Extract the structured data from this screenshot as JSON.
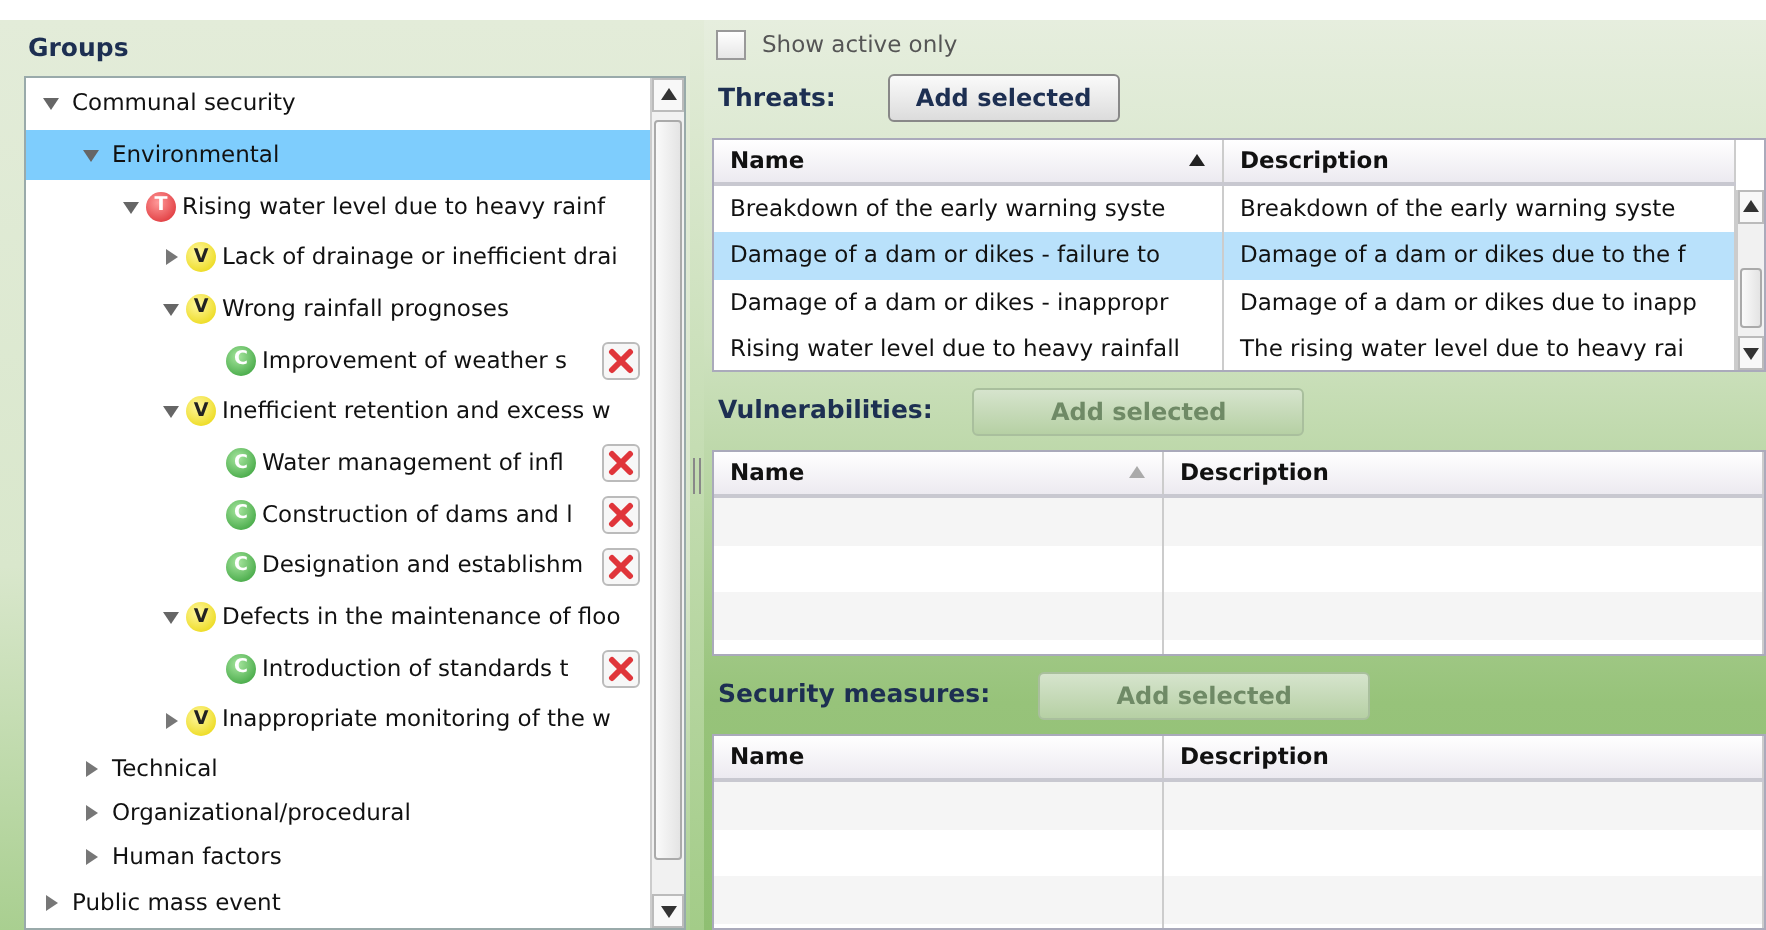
{
  "groups_panel": {
    "title": "Groups",
    "tree": [
      {
        "label": "Communal security",
        "kind": "group",
        "expanded": true,
        "selected": false,
        "children": [
          {
            "label": "Environmental",
            "kind": "group",
            "expanded": true,
            "selected": true,
            "children": [
              {
                "label": "Rising water level due to heavy rainf",
                "kind": "threat",
                "badge": "T",
                "expanded": true,
                "selected": false,
                "children": [
                  {
                    "label": "Lack of drainage or inefficient drai",
                    "kind": "vulnerability",
                    "badge": "V",
                    "expanded": false,
                    "selected": false
                  },
                  {
                    "label": "Wrong rainfall prognoses",
                    "kind": "vulnerability",
                    "badge": "V",
                    "expanded": true,
                    "selected": false,
                    "children": [
                      {
                        "label": "Improvement of weather s",
                        "kind": "countermeasure",
                        "badge": "C",
                        "selected": false
                      }
                    ]
                  },
                  {
                    "label": "Inefficient retention and excess w",
                    "kind": "vulnerability",
                    "badge": "V",
                    "expanded": true,
                    "selected": false,
                    "children": [
                      {
                        "label": "Water management of infl",
                        "kind": "countermeasure",
                        "badge": "C",
                        "selected": false
                      },
                      {
                        "label": "Construction of dams and l",
                        "kind": "countermeasure",
                        "badge": "C",
                        "selected": false
                      },
                      {
                        "label": "Designation and establishm",
                        "kind": "countermeasure",
                        "badge": "C",
                        "selected": false
                      }
                    ]
                  },
                  {
                    "label": "Defects in the maintenance of floo",
                    "kind": "vulnerability",
                    "badge": "V",
                    "expanded": true,
                    "selected": false,
                    "children": [
                      {
                        "label": "Introduction of standards t",
                        "kind": "countermeasure",
                        "badge": "C",
                        "selected": false
                      }
                    ]
                  },
                  {
                    "label": "Inappropriate monitoring of the w",
                    "kind": "vulnerability",
                    "badge": "V",
                    "expanded": false,
                    "selected": false
                  }
                ]
              }
            ]
          },
          {
            "label": "Technical",
            "kind": "group",
            "expanded": false,
            "selected": false
          },
          {
            "label": "Organizational/procedural",
            "kind": "group",
            "expanded": false,
            "selected": false
          },
          {
            "label": "Human factors",
            "kind": "group",
            "expanded": false,
            "selected": false
          }
        ]
      },
      {
        "label": "Public mass event",
        "kind": "group",
        "expanded": false,
        "selected": false
      }
    ]
  },
  "show_active_only": {
    "label": "Show active only",
    "checked": false
  },
  "sections": [
    {
      "title": "Threats:",
      "button": {
        "label": "Add selected",
        "disabled": false
      },
      "columns": [
        {
          "label": "Name",
          "sort_ascending": true
        },
        {
          "label": "Description"
        }
      ],
      "rows": [
        {
          "cells": [
            "Breakdown of the early warning syste",
            "Breakdown of the early warning syste"
          ],
          "selected": false
        },
        {
          "cells": [
            "Damage of a dam or dikes -  failure to",
            "Damage of a dam or dikes due to the f"
          ],
          "selected": true
        },
        {
          "cells": [
            "Damage of a dam or dikes -  inappropr",
            "Damage of a dam or dikes due to inapp"
          ],
          "selected": false
        },
        {
          "cells": [
            "Rising water level due to heavy rainfall",
            "The rising water level due to heavy rai"
          ],
          "selected": false
        }
      ]
    },
    {
      "title": "Vulnerabilities:",
      "button": {
        "label": "Add selected",
        "disabled": true
      },
      "columns": [
        {
          "label": "Name",
          "sort_ascending": true
        },
        {
          "label": "Description"
        }
      ]
    },
    {
      "title": "Security measures:",
      "button": {
        "label": "Add selected",
        "disabled": true
      },
      "columns": [
        {
          "label": "Name"
        },
        {
          "label": "Description"
        }
      ]
    }
  ]
}
